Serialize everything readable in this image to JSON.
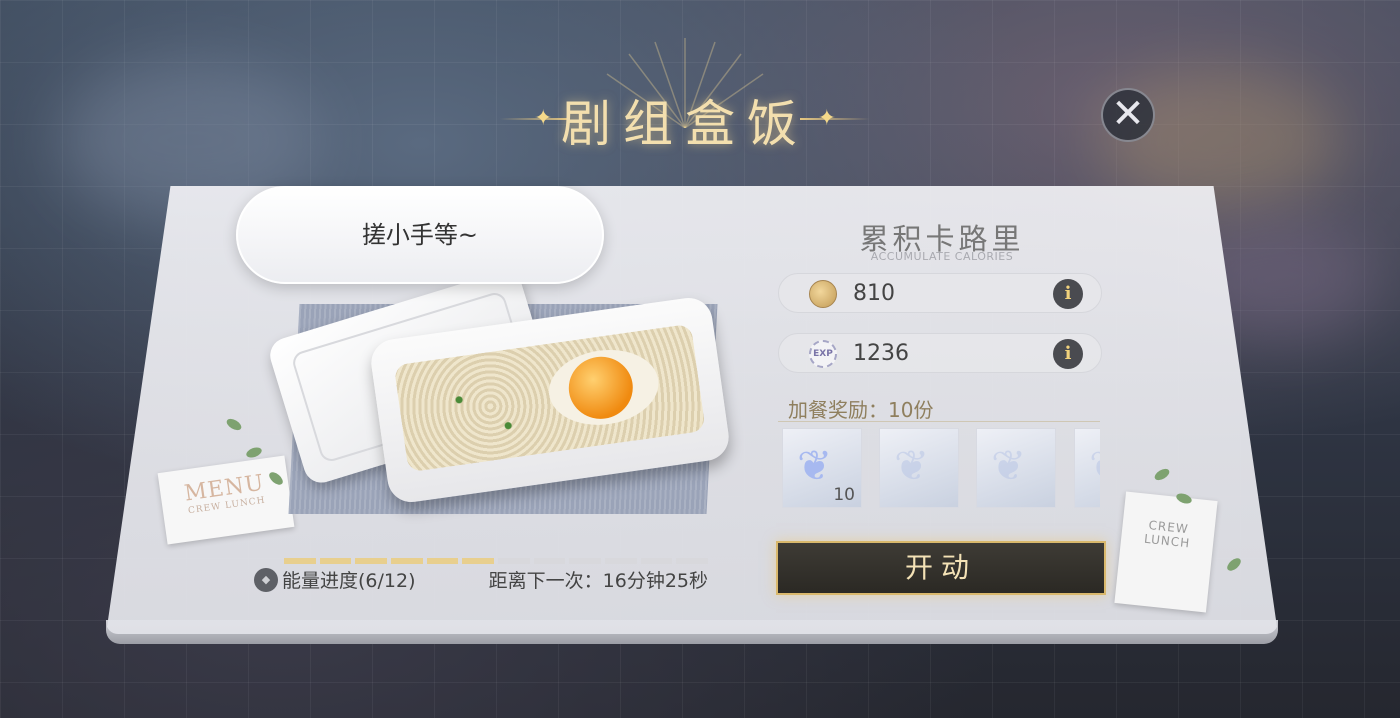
{
  "header": {
    "title": "剧组盒饭",
    "close_symbol": "✕"
  },
  "bubble": {
    "text": "搓小手等~"
  },
  "decor": {
    "menu_title": "MENU",
    "menu_sub": "CREW LUNCH",
    "crew_card_line1": "CREW",
    "crew_card_line2": "LUNCH"
  },
  "energy": {
    "icon_glyph": "◆",
    "label": "能量进度(6/12)",
    "current": 6,
    "total": 12,
    "next_label": "距离下一次：16分钟25秒"
  },
  "calories": {
    "title": "累积卡路里",
    "subtitle": "ACCUMULATE CALORIES",
    "stats": [
      {
        "icon": "gold-coin-icon",
        "value": "810",
        "info_symbol": "i"
      },
      {
        "icon": "exp-badge-icon",
        "icon_text": "EXP",
        "value": "1236",
        "info_symbol": "i"
      }
    ]
  },
  "bonus": {
    "label": "加餐奖励：10份",
    "rewards": [
      {
        "icon": "butterfly-icon",
        "count": "10"
      },
      {
        "icon": "butterfly-icon",
        "count": ""
      },
      {
        "icon": "butterfly-icon",
        "count": ""
      },
      {
        "icon": "butterfly-icon",
        "count": ""
      }
    ]
  },
  "action": {
    "start_label": "开动"
  },
  "colors": {
    "gold_accent": "#e8c982",
    "button_dark": "#2b2924",
    "energy_filled": "#e8cf8e",
    "energy_empty": "#d8d8dc"
  }
}
